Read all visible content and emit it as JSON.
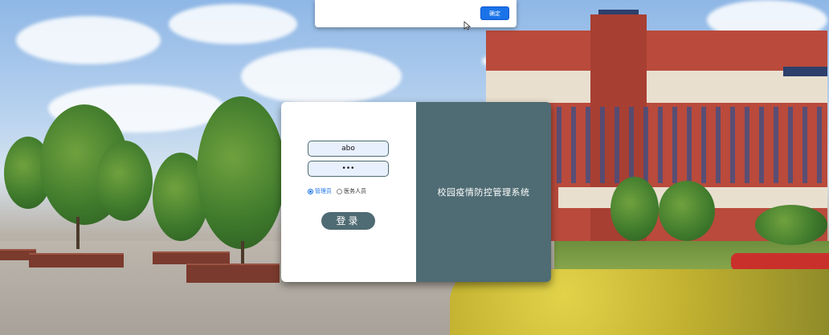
{
  "alert": {
    "confirm_label": "确定"
  },
  "login": {
    "username_value": "abo",
    "password_value": "•••",
    "roles": [
      {
        "label": "管理员",
        "checked": true
      },
      {
        "label": "医务人员",
        "checked": false
      }
    ],
    "submit_label": "登录"
  },
  "branding": {
    "system_title": "校园疫情防控管理系统"
  },
  "colors": {
    "panel": "#4f6b73",
    "accent": "#1a73e8",
    "input_bg": "#e8f0fe"
  },
  "icons": {
    "cursor": "mouse-pointer-icon"
  }
}
